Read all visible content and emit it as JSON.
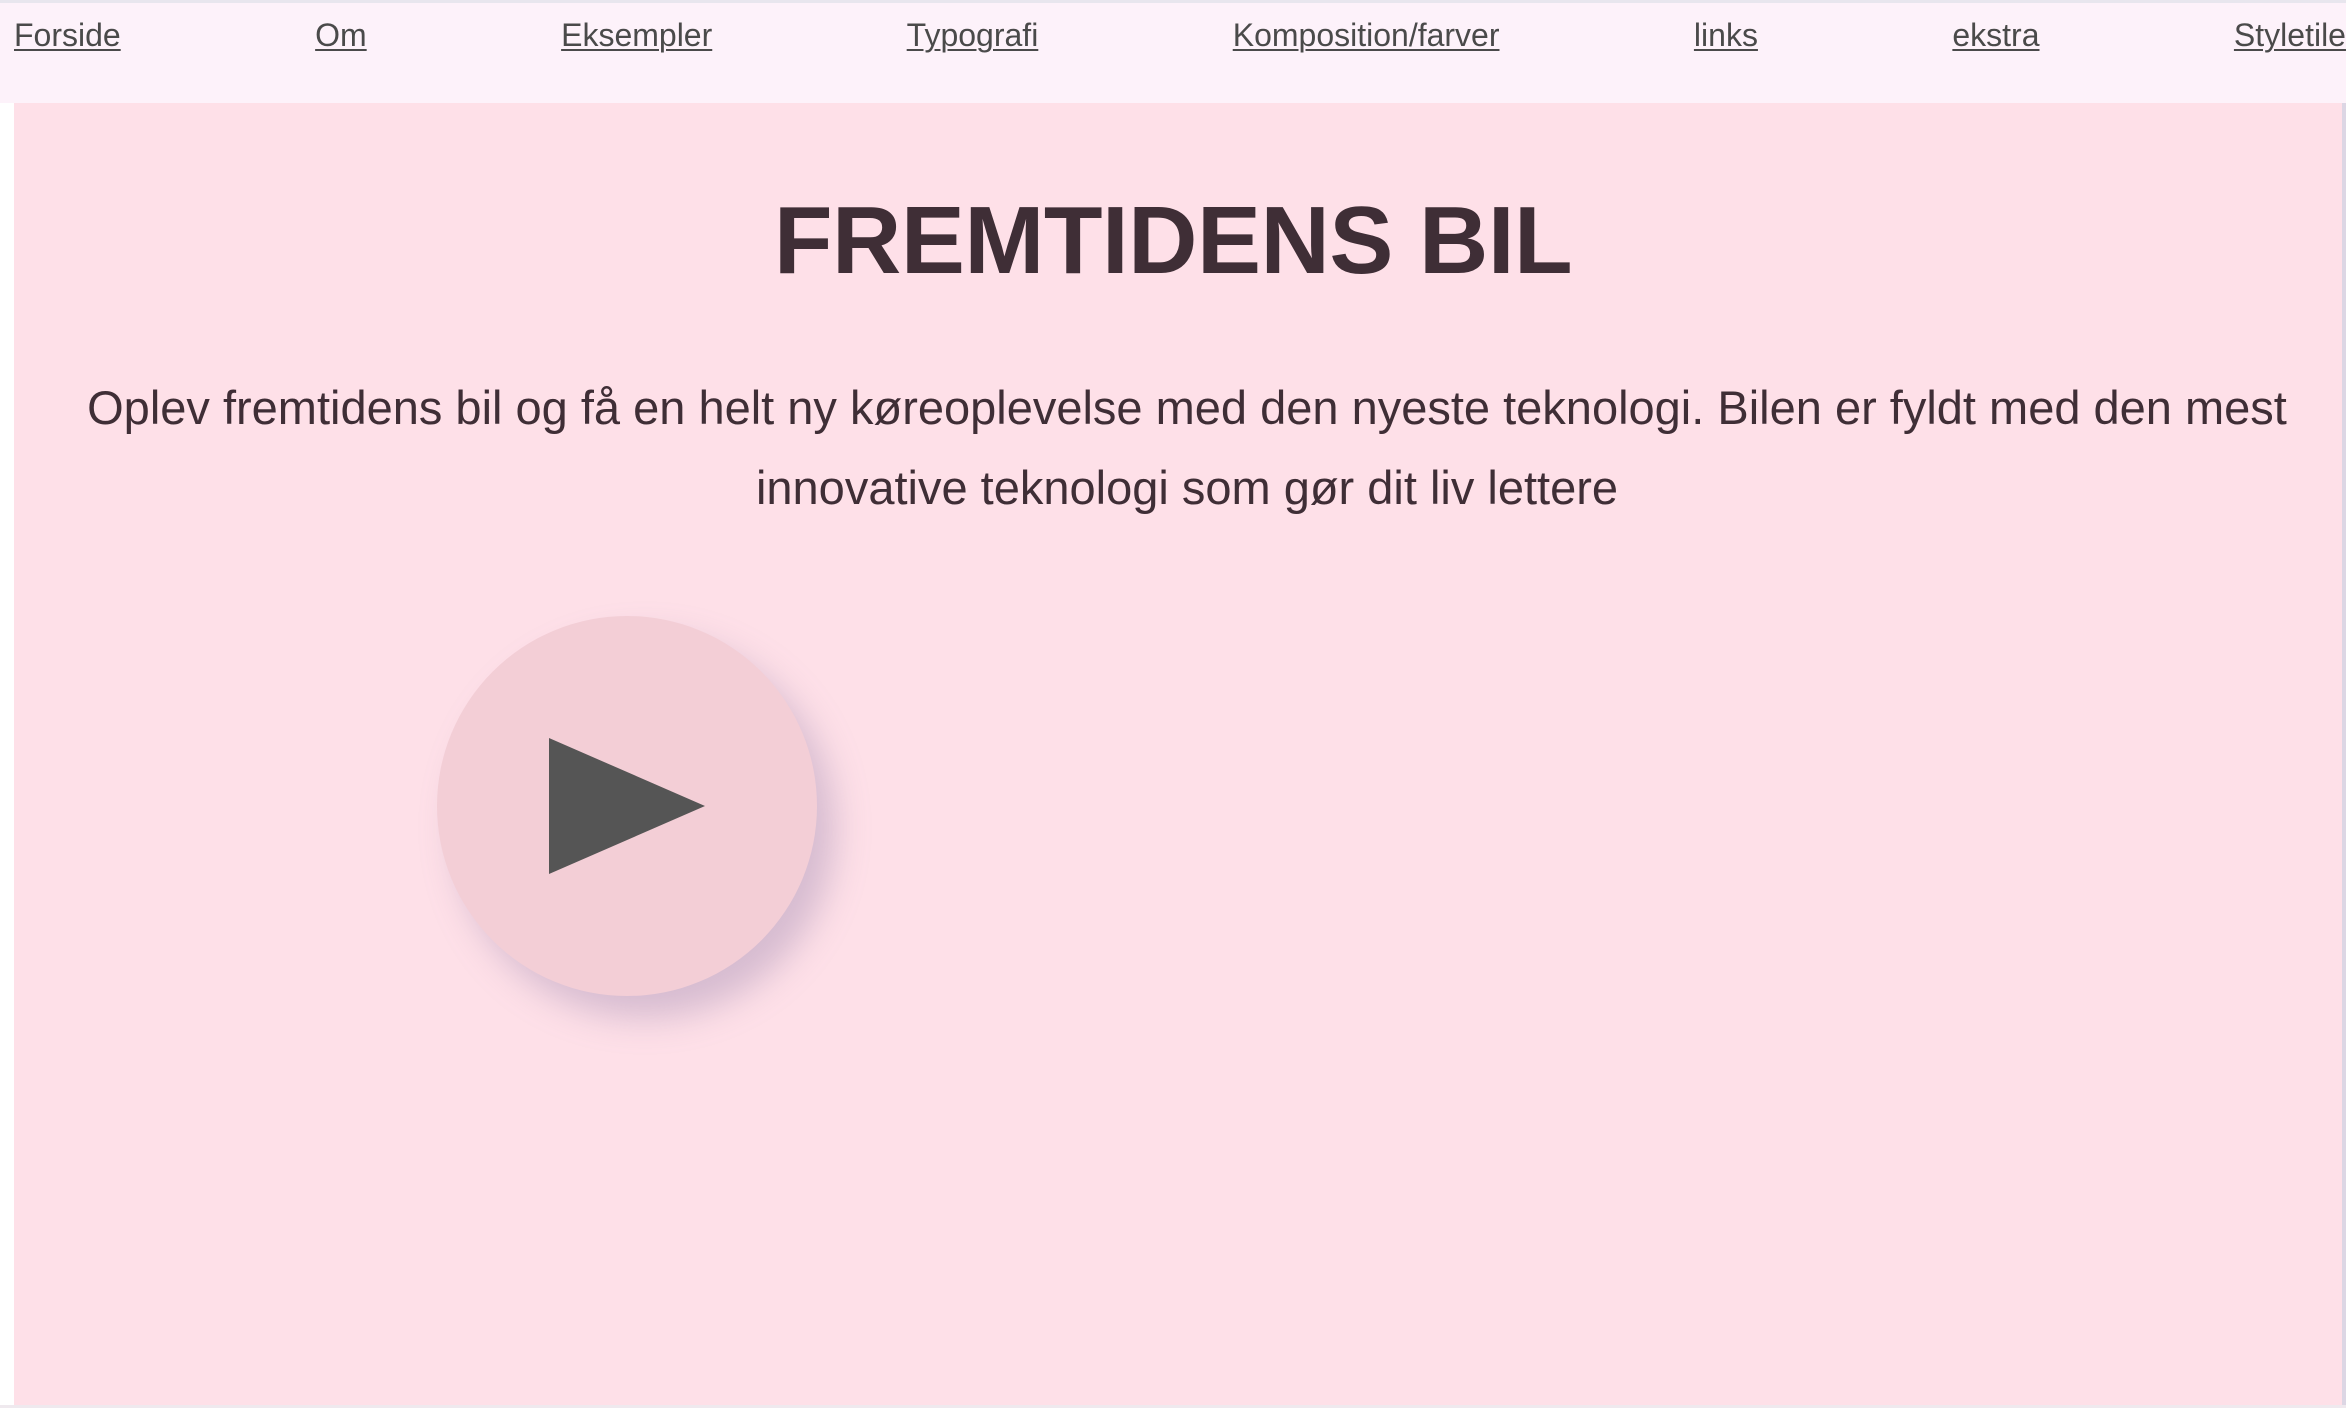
{
  "nav": {
    "items": [
      {
        "label": "Forside"
      },
      {
        "label": "Om"
      },
      {
        "label": "Eksempler"
      },
      {
        "label": "Typografi"
      },
      {
        "label": "Komposition/farver"
      },
      {
        "label": "links"
      },
      {
        "label": "ekstra"
      },
      {
        "label": "Styletile"
      }
    ]
  },
  "hero": {
    "title": "FREMTIDENS BIL",
    "text": "Oplev fremtidens bil og få en helt ny køreoplevelse med den nyeste teknologi. Bilen er fyldt med den mest innovative teknologi som gør dit liv lettere",
    "play_icon": "play-icon"
  },
  "colors": {
    "nav_background": "#fdf2fa",
    "hero_background": "#fee0e8",
    "text": "#3f2e36",
    "link": "#4a4a4a",
    "play_button": "#f3ced6",
    "play_icon": "#555555"
  }
}
